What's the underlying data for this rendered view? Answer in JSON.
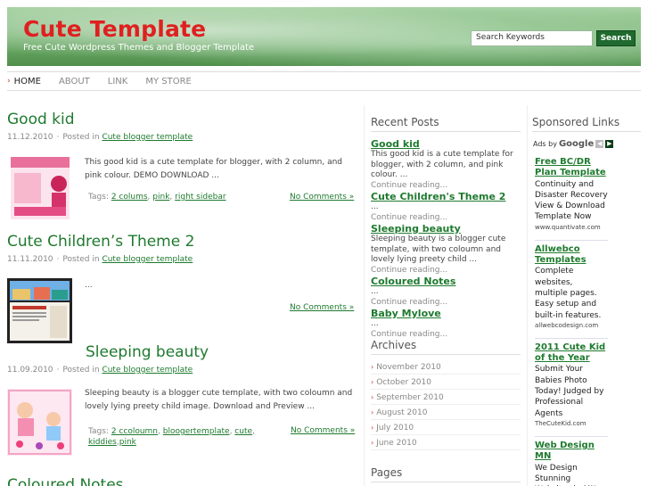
{
  "site": {
    "title": "Cute Template",
    "tagline": "Free Cute Wordpress Themes and Blogger Template",
    "colors": {
      "title": "#e02020",
      "link": "#1e7a2e",
      "header_green": "#6fae6b",
      "button": "#1f6a2e"
    }
  },
  "search": {
    "value": "Search Keywords",
    "button_label": "Search"
  },
  "nav": {
    "active_arrow": "›",
    "items": [
      {
        "label": "HOME"
      },
      {
        "label": "ABOUT"
      },
      {
        "label": "LINK"
      },
      {
        "label": "MY STORE"
      }
    ]
  },
  "posts": [
    {
      "title": "Good kid",
      "date": "11.12.2010",
      "posted_in": "Posted in",
      "category": "Cute blogger template",
      "excerpt": "This good kid is a cute template for blogger, with 2 column, and pink colour. DEMO DOWNLOAD ...",
      "tags_label": "Tags:",
      "tags": [
        "2 colums",
        "pink",
        "right sidebar"
      ],
      "comments": "No Comments »"
    },
    {
      "title": "Cute Children’s Theme 2",
      "date": "11.11.2010",
      "posted_in": "Posted in",
      "category": "Cute blogger template",
      "excerpt": "...",
      "comments": "No Comments »"
    },
    {
      "title": "Sleeping beauty",
      "date": "11.09.2010",
      "posted_in": "Posted in",
      "category": "Cute blogger template",
      "excerpt": "Sleeping beauty is a blogger cute template, with two coloumn and lovely lying preety child image. Download and Preview ...",
      "tags_label": "Tags:",
      "tags": [
        "2 ccoloumn",
        "bloogertemplate",
        "cute",
        "kiddies",
        "pink"
      ],
      "comments": "No Comments »"
    },
    {
      "title": "Coloured Notes"
    }
  ],
  "recent_posts": {
    "heading": "Recent Posts",
    "more_label": "Continue reading...",
    "items": [
      {
        "title": "Good kid",
        "excerpt": "This good kid is a cute template for blogger, with 2 column, and pink colour. ..."
      },
      {
        "title": "Cute Children's Theme 2",
        "excerpt": "..."
      },
      {
        "title": "Sleeping beauty",
        "excerpt": "Sleeping beauty is a blogger cute template, with two coloumn and lovely lying preety child ..."
      },
      {
        "title": "Coloured Notes",
        "excerpt": "..."
      },
      {
        "title": "Baby Mylove",
        "excerpt": "..."
      }
    ]
  },
  "archives": {
    "heading": "Archives",
    "items": [
      "November 2010",
      "October 2010",
      "September 2010",
      "August 2010",
      "July 2010",
      "June 2010"
    ]
  },
  "pages": {
    "heading": "Pages"
  },
  "sponsored": {
    "heading": "Sponsored Links",
    "ads_by": "Ads by",
    "google": "Google",
    "ads": [
      {
        "title": "Free BC/DR Plan Template",
        "text": "Continuity and Disaster Recovery View & Download Template Now",
        "url": "www.quantivate.com"
      },
      {
        "title": "Allwebco Templates",
        "text": "Complete websites, multiple pages. Easy setup and built-in features.",
        "url": "allwebcodesign.com"
      },
      {
        "title": "2011 Cute Kid of the Year",
        "text": "Submit Your Babies Photo Today! Judged by Professional Agents",
        "url": "TheCuteKid.com"
      },
      {
        "title": "Web Design MN",
        "text": "We Design Stunning Websites in MN.",
        "url": ""
      }
    ]
  }
}
